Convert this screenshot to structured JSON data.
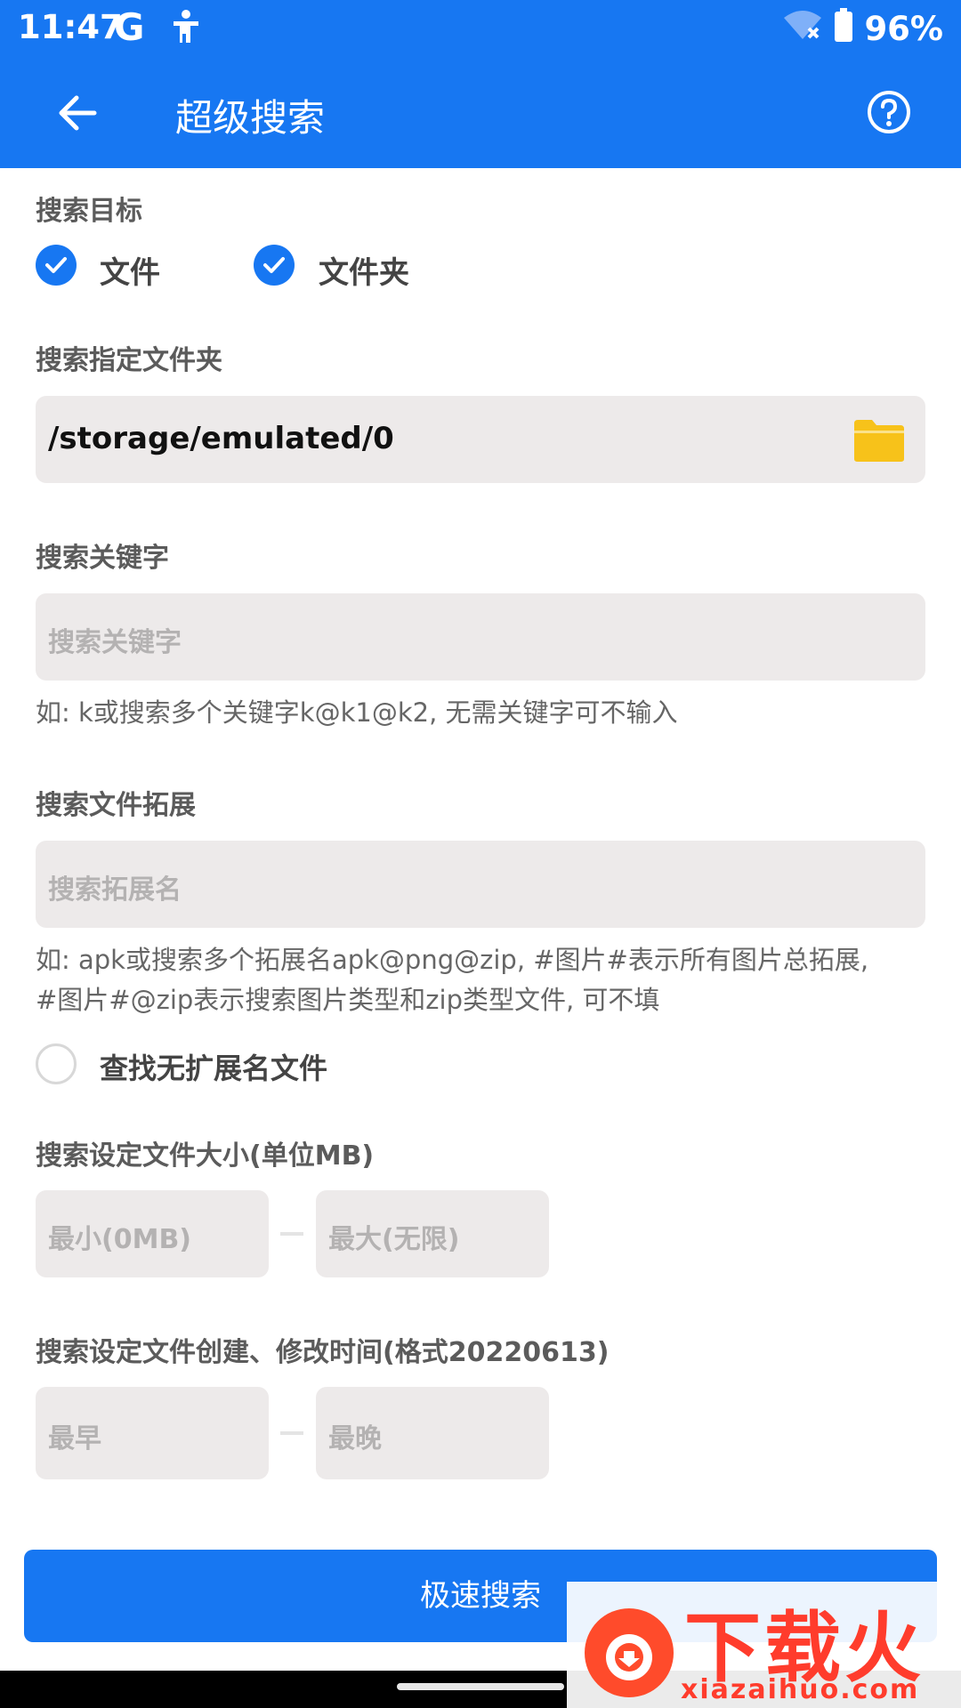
{
  "status_bar": {
    "time": "11:47",
    "g_label": "G",
    "battery": "96%"
  },
  "app_bar": {
    "title": "超级搜索",
    "back_icon": "arrow-left-icon",
    "help_icon": "help-circle-icon"
  },
  "target": {
    "label": "搜索目标",
    "options": [
      {
        "label": "文件",
        "checked": true
      },
      {
        "label": "文件夹",
        "checked": true
      }
    ]
  },
  "folder": {
    "label": "搜索指定文件夹",
    "value": "/storage/emulated/0"
  },
  "keyword": {
    "label": "搜索关键字",
    "placeholder": "搜索关键字",
    "hint": "如: k或搜索多个关键字k@k1@k2, 无需关键字可不输入"
  },
  "extension": {
    "label": "搜索文件拓展",
    "placeholder": "搜索拓展名",
    "hint_line1": "如: apk或搜索多个拓展名apk@png@zip, #图片#表示所有图片总拓展,",
    "hint_line2": "#图片#@zip表示搜索图片类型和zip类型文件, 可不填",
    "no_ext_label": "查找无扩展名文件",
    "no_ext_checked": false
  },
  "size": {
    "label": "搜索设定文件大小(单位MB)",
    "min_placeholder": "最小(0MB)",
    "max_placeholder": "最大(无限)"
  },
  "time": {
    "label": "搜索设定文件创建、修改时间(格式20220613)",
    "earliest_placeholder": "最早",
    "latest_placeholder": "最晚"
  },
  "submit_label": "极速搜索",
  "watermark": {
    "text": "下载火",
    "domain": "xiazaihuo.com"
  },
  "colors": {
    "accent": "#1777f2",
    "field_bg": "#edeaea",
    "folder_icon": "#f7c21a"
  }
}
